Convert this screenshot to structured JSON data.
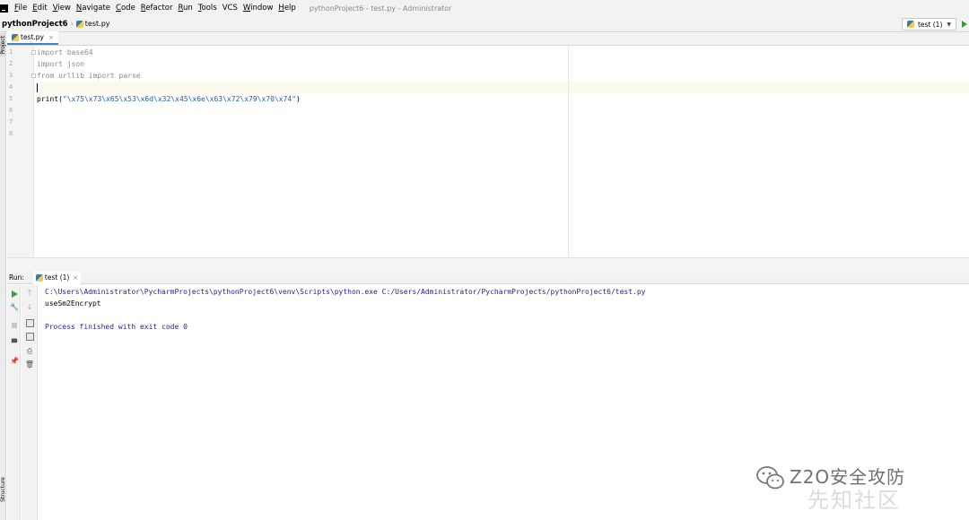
{
  "menubar": {
    "items": [
      {
        "mnemonic": "F",
        "rest": "ile"
      },
      {
        "mnemonic": "E",
        "rest": "dit"
      },
      {
        "mnemonic": "V",
        "rest": "iew"
      },
      {
        "mnemonic": "N",
        "rest": "avigate"
      },
      {
        "mnemonic": "C",
        "rest": "ode"
      },
      {
        "mnemonic": "R",
        "rest": "efactor"
      },
      {
        "mnemonic": "R",
        "rest": "un"
      },
      {
        "mnemonic": "T",
        "rest": "ools"
      },
      {
        "mnemonic": "",
        "rest": "VCS"
      },
      {
        "mnemonic": "W",
        "rest": "indow"
      },
      {
        "mnemonic": "H",
        "rest": "elp"
      }
    ],
    "window_title": "pythonProject6 - test.py - Administrator"
  },
  "navbar": {
    "project": "pythonProject6",
    "file": "test.py",
    "run_config": "test (1)"
  },
  "tool_stripe": {
    "project_label": "Project",
    "structure_label": "Structure"
  },
  "editor": {
    "tab_label": "test.py",
    "tab_close": "×",
    "line_numbers": [
      "1",
      "2",
      "3",
      "4",
      "5",
      "6",
      "7",
      "8"
    ],
    "lines": {
      "l1": "import base64",
      "l2": "import json",
      "l3": "from urllib import parse",
      "l4": "",
      "l5_prefix": "print(",
      "l5_string": "\"\\x75\\x73\\x65\\x53\\x6d\\x32\\x45\\x6e\\x63\\x72\\x79\\x70\\x74\"",
      "l5_suffix": ")"
    }
  },
  "run_panel": {
    "label": "Run:",
    "tab_label": "test (1)",
    "tab_close": "×",
    "console_lines": [
      "C:\\Users\\Administrator\\PycharmProjects\\pythonProject6\\venv\\Scripts\\python.exe C:/Users/Administrator/PycharmProjects/pythonProject6/test.py",
      "useSm2Encrypt",
      "",
      "Process finished with exit code 0"
    ]
  },
  "watermark": {
    "brand": "Z2O安全攻防",
    "site": "先知社区"
  },
  "icons": {
    "run": "play-icon",
    "stop": "stop-icon",
    "wrench": "wrench-icon",
    "layout": "layout-icon",
    "pin": "pin-icon",
    "up": "arrow-up-icon",
    "down": "arrow-down-icon",
    "soft_wrap": "soft-wrap-icon",
    "scroll_end": "scroll-to-end-icon",
    "print": "print-icon",
    "trash": "trash-icon"
  },
  "colors": {
    "string": "#1e5bb8",
    "console_text": "#22229c",
    "run_green": "#3b9a3b",
    "tab_underline": "#4083c9"
  }
}
